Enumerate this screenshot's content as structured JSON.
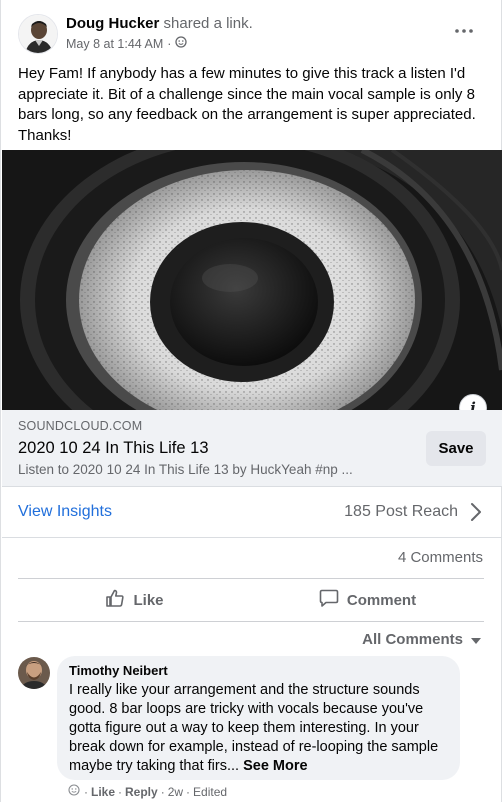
{
  "post": {
    "author": "Doug Hucker",
    "action": "shared a link.",
    "date": "May 8 at 1:44 AM",
    "text": "Hey Fam! If anybody has a few minutes to give this track a listen I'd appreciate it. Bit of a challenge since the main vocal sample is only 8 bars long, so any feedback on the arrangement is super appreciated. Thanks!"
  },
  "link": {
    "domain": "SOUNDCLOUD.COM",
    "title": "2020 10 24 In This Life 13",
    "description": "Listen to 2020 10 24 In This Life 13 by HuckYeah #np ...",
    "save_label": "Save",
    "info_label": "i"
  },
  "insights": {
    "view_label": "View Insights",
    "reach": "185 Post Reach"
  },
  "comments_count": "4 Comments",
  "actions": {
    "like": "Like",
    "comment": "Comment"
  },
  "all_comments_label": "All Comments",
  "comment": {
    "author": "Timothy Neibert",
    "text": "I really like your arrangement and the structure sounds good. 8 bar loops are tricky with vocals because you've gotta figure out a way to keep them interesting. In your break down for example, instead of re-looping the sample maybe try taking that firs...",
    "see_more": "See More",
    "like": "Like",
    "reply": "Reply",
    "time": "2w",
    "edited": "Edited"
  },
  "colors": {
    "link_blue": "#216fdb",
    "secondary_text": "#65676b",
    "bubble_bg": "#f0f2f5"
  }
}
